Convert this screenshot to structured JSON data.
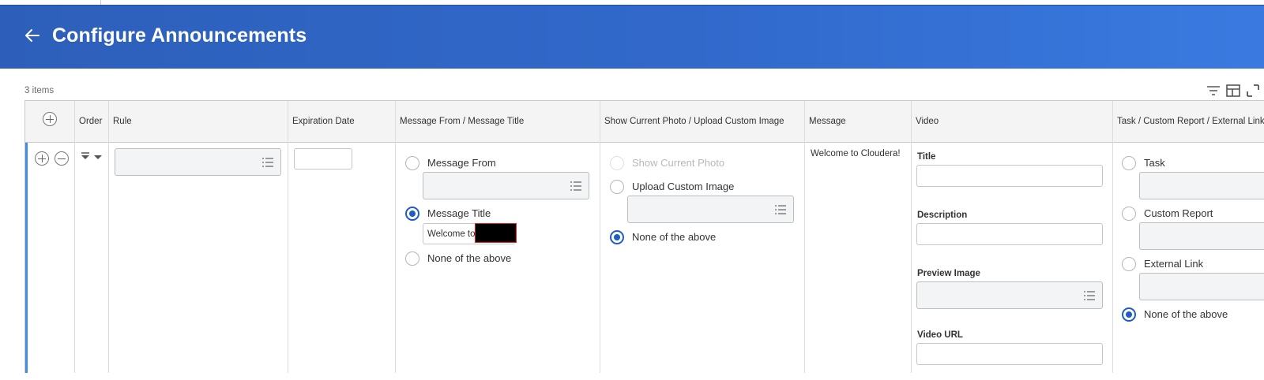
{
  "header": {
    "title": "Configure Announcements"
  },
  "table": {
    "item_count": "3 items",
    "columns": [
      "Order",
      "Rule",
      "Expiration Date",
      "Message From / Message Title",
      "Show Current Photo / Upload Custom Image",
      "Message",
      "Video",
      "Task / Custom Report / External Link"
    ],
    "row": {
      "message_from": {
        "options": [
          "Message From",
          "Message Title",
          "None of the above"
        ],
        "selected": "Message Title",
        "title_value": "Welcome to"
      },
      "image": {
        "options": [
          "Show Current Photo",
          "Upload Custom Image",
          "None of the above"
        ],
        "selected": "None of the above"
      },
      "message": "Welcome to Cloudera!",
      "video": {
        "title_label": "Title",
        "description_label": "Description",
        "preview_label": "Preview Image",
        "url_label": "Video URL"
      },
      "link": {
        "options": [
          "Task",
          "Custom Report",
          "External Link",
          "None of the above"
        ],
        "selected": "None of the above"
      }
    }
  },
  "icons": [
    "back-arrow-icon",
    "filter-icon",
    "column-layout-icon",
    "fullscreen-icon",
    "add-row-icon",
    "remove-row-icon",
    "list-icon"
  ],
  "colors": {
    "header": "#3169cb",
    "accent": "#1f5cc4",
    "row_indicator": "#3f8de6"
  }
}
